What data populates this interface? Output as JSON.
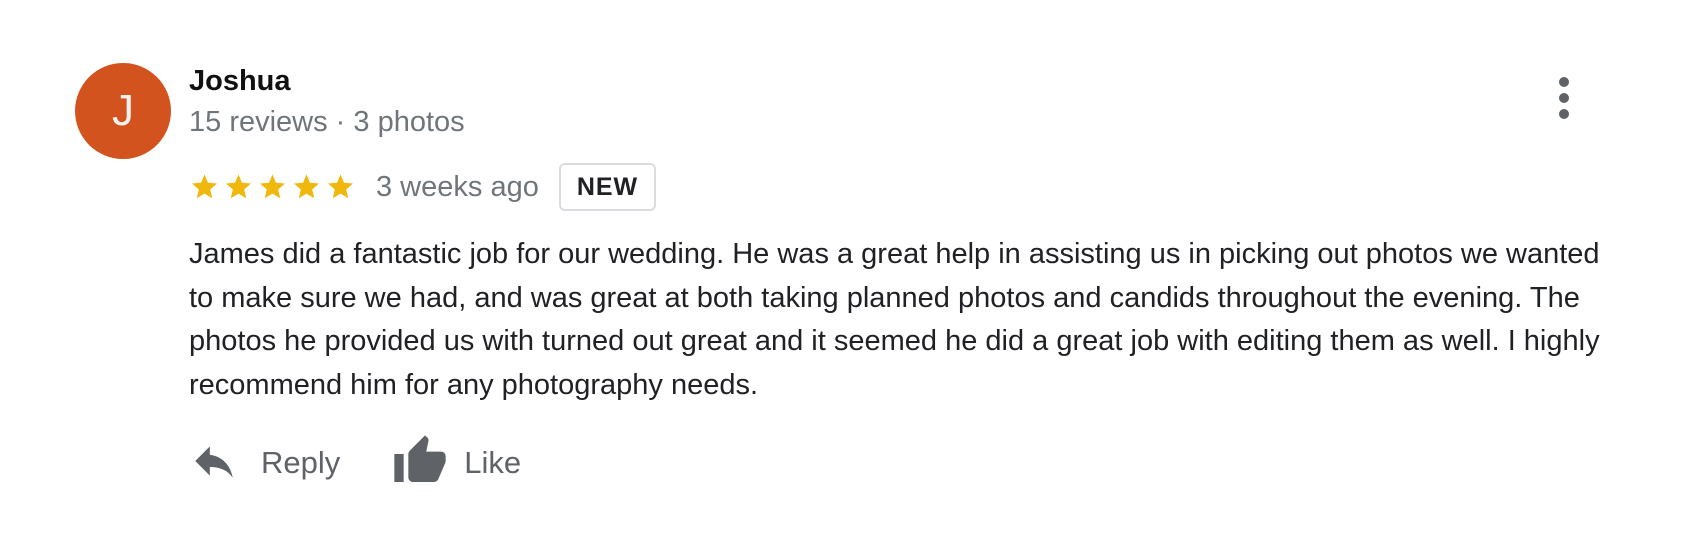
{
  "author": {
    "avatar_initial": "J",
    "avatar_color": "#d2531e",
    "name": "Joshua",
    "meta": "15 reviews · 3 photos"
  },
  "menu": {
    "icon": "more-vert-icon"
  },
  "rating": {
    "stars": 5,
    "max_stars": 5,
    "star_color": "#f0b70d",
    "time_ago": "3 weeks ago",
    "badge": "NEW"
  },
  "review": {
    "text": "James did a fantastic job for our wedding. He was a great help in assisting us in picking out photos we wanted to make sure we had, and was great at both taking planned photos and candids throughout the evening. The photos he provided us with turned out great and it seemed he did a great job with editing them as well. I highly recommend him for any photography needs."
  },
  "actions": {
    "reply_label": "Reply",
    "reply_icon": "reply-icon",
    "like_label": "Like",
    "like_icon": "thumb-up-icon"
  }
}
